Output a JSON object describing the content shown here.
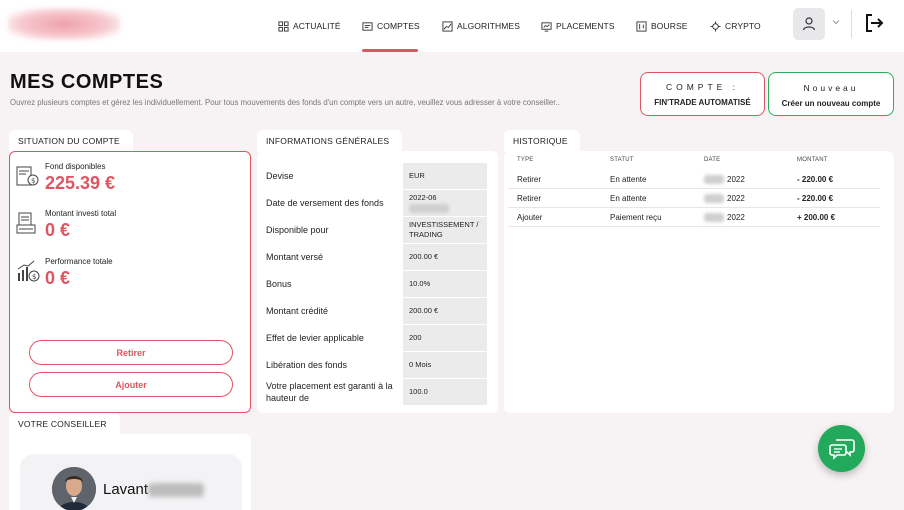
{
  "nav": {
    "items": [
      {
        "label": "ACTUALITÉ",
        "icon": "grid-icon"
      },
      {
        "label": "COMPTES",
        "icon": "wallet-icon",
        "active": true
      },
      {
        "label": "ALGORITHMES",
        "icon": "chart-icon"
      },
      {
        "label": "PLACEMENTS",
        "icon": "investment-icon"
      },
      {
        "label": "BOURSE",
        "icon": "stock-icon"
      },
      {
        "label": "CRYPTO",
        "icon": "crypto-icon"
      }
    ],
    "accent": "#e05562"
  },
  "header": {
    "title": "MES COMPTES",
    "subtitle": "Ouvrez plusieurs comptes et gérez les individuellement. Pour tous mouvements des fonds d'un compte vers un autre, veuillez vous adresser à votre conseiller..",
    "compte_label": "COMPTE :",
    "compte_value": "FIN'TRADE AUTOMATISÉ",
    "new_label": "Nouveau",
    "new_action": "Créer un nouveau compte"
  },
  "situation": {
    "tab": "SITUATION DU COMPTE",
    "fonds_label": "Fond disponibles",
    "fonds_value": "225.39 €",
    "investi_label": "Montant investi total",
    "investi_value": "0 €",
    "perf_label": "Performance totale",
    "perf_value": "0 €",
    "retirer": "Retirer",
    "ajouter": "Ajouter"
  },
  "infos": {
    "tab": "INFORMATIONS GÉNÉRALES",
    "rows": [
      {
        "key": "Devise",
        "value": "EUR"
      },
      {
        "key": "Date de versement des fonds",
        "value": "2022-06"
      },
      {
        "key": "Disponible pour",
        "value": "INVESTISSEMENT / TRADING"
      },
      {
        "key": "Montant versé",
        "value": "200.00 €"
      },
      {
        "key": "Bonus",
        "value": "10.0%"
      },
      {
        "key": "Montant crédité",
        "value": "200.00 €"
      },
      {
        "key": "Effet de levier applicable",
        "value": "200"
      },
      {
        "key": "Libération des fonds",
        "value": "0 Mois"
      },
      {
        "key": "Votre placement est garanti à la hauteur de",
        "value": "100.0"
      }
    ]
  },
  "historique": {
    "tab": "HISTORIQUE",
    "headers": {
      "type": "TYPE",
      "statut": "STATUT",
      "date": "DATE",
      "montant": "MONTANT"
    },
    "rows": [
      {
        "type": "Retirer",
        "statut": "En attente",
        "date": "2022",
        "montant": "- 220.00 €"
      },
      {
        "type": "Retirer",
        "statut": "En attente",
        "date": "2022",
        "montant": "- 220.00 €"
      },
      {
        "type": "Ajouter",
        "statut": "Paiement reçu",
        "date": "2022",
        "montant": "+ 200.00 €"
      }
    ]
  },
  "conseiller": {
    "tab": "VOTRE CONSEILLER",
    "name": "Lavant"
  }
}
